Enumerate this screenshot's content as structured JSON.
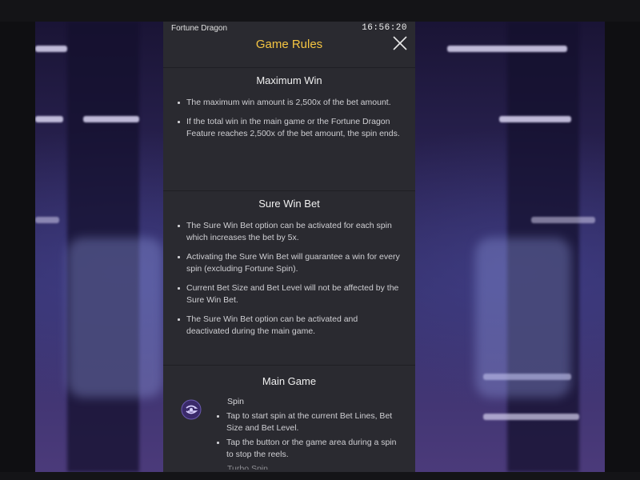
{
  "app": {
    "name": "Fortune Dragon",
    "clock": "16:56:20"
  },
  "header": {
    "title": "Game Rules",
    "close_icon": "close-icon"
  },
  "colors": {
    "title": "#f5c542",
    "panel": "#2a2a30",
    "text": "#cfcfd3"
  },
  "sections": {
    "max_win": {
      "title": "Maximum Win",
      "bullets": [
        "The maximum win amount is 2,500x of the bet amount.",
        "If the total win in the main game or the Fortune Dragon Feature reaches 2,500x of the bet amount, the spin ends."
      ]
    },
    "sure_win": {
      "title": "Sure Win Bet",
      "bullets": [
        "The Sure Win Bet option can be activated for each spin which increases the bet by 5x.",
        "Activating the Sure Win Bet will guarantee a win for every spin (excluding Fortune Spin).",
        "Current Bet Size and Bet Level will not be affected by the Sure Win Bet.",
        "The Sure Win Bet option can be activated and deactivated during the main game."
      ]
    },
    "main_game": {
      "title": "Main Game",
      "spin": {
        "title": "Spin",
        "icon": "spin-icon",
        "bullets": [
          "Tap to start spin at the current Bet Lines, Bet Size and Bet Level.",
          "Tap the button or the game area during a spin to stop the reels."
        ]
      },
      "next_label_partial": "Turbo Spin"
    }
  }
}
